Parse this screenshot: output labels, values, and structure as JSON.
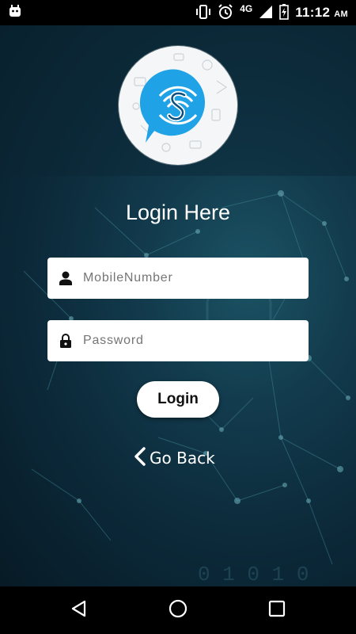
{
  "status_bar": {
    "network": "4G",
    "time": "11:12",
    "ampm": "AM"
  },
  "login": {
    "title": "Login Here",
    "mobile_placeholder": "MobileNumber",
    "password_placeholder": "Password",
    "login_label": "Login",
    "go_back_label": "Go Back"
  },
  "icons": {
    "status_left": "android-notification-icon",
    "vibrate": "vibrate-icon",
    "alarm": "alarm-icon",
    "signal": "signal-icon",
    "battery": "battery-charging-icon",
    "user": "person-icon",
    "lock": "lock-icon",
    "back_chevron": "chevron-left-icon",
    "nav_back": "triangle-back-icon",
    "nav_home": "circle-home-icon",
    "nav_recents": "square-recents-icon"
  },
  "colors": {
    "logo_blue": "#1fa3e6",
    "background_dark": "#0b2230",
    "field_bg": "#ffffff"
  }
}
